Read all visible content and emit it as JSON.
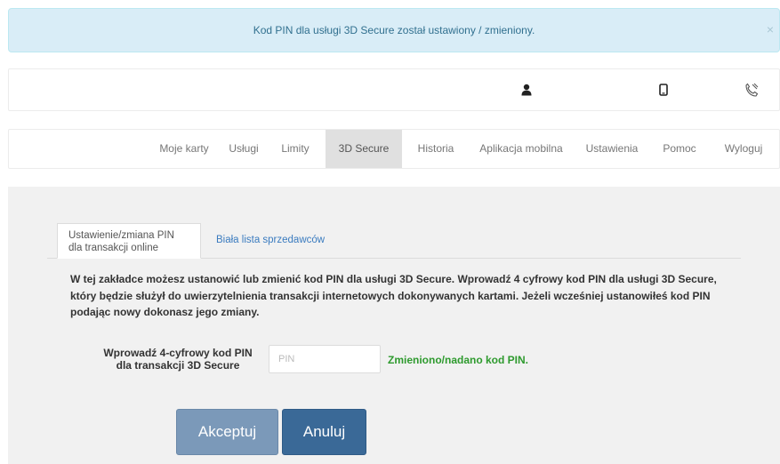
{
  "alert": {
    "message": "Kod PIN dla usługi 3D Secure został ustawiony / zmieniony.",
    "close": "×"
  },
  "userbar": {
    "icons": [
      "user-icon",
      "phone-icon",
      "phone-handset-icon"
    ]
  },
  "nav": {
    "items": [
      {
        "label": "Moje karty"
      },
      {
        "label": "Usługi"
      },
      {
        "label": "Limity"
      },
      {
        "label": "3D Secure",
        "active": true
      },
      {
        "label": "Historia"
      },
      {
        "label": "Aplikacja mobilna"
      },
      {
        "label": "Ustawienia"
      },
      {
        "label": "Pomoc"
      },
      {
        "label": "Wyloguj"
      }
    ]
  },
  "tabs": {
    "active_line1": "Ustawienie/zmiana PIN",
    "active_line2": "dla transakcji online",
    "second": "Biała lista sprzedawców"
  },
  "description": "W tej zakładce możesz ustanowić lub zmienić kod PIN dla usługi 3D Secure. Wprowadź 4 cyfrowy kod PIN dla usługi 3D Secure, który będzie służył do uwierzytelnienia transakcji internetowych dokonywanych kartami. Jeżeli wcześniej ustanowiłeś kod PIN podając nowy dokonasz jego zmiany.",
  "pin": {
    "label_line1": "Wprowadź 4-cyfrowy kod PIN",
    "label_line2": "dla transakcji 3D Secure",
    "placeholder": "PIN",
    "value": "",
    "status": "Zmieniono/nadano kod PIN."
  },
  "buttons": {
    "accept": "Akceptuj",
    "cancel": "Anuluj"
  },
  "colors": {
    "alert_bg": "#d9edf7",
    "success": "#2e9a2e",
    "primary": "#3a6997",
    "link": "#3a7bbf"
  }
}
